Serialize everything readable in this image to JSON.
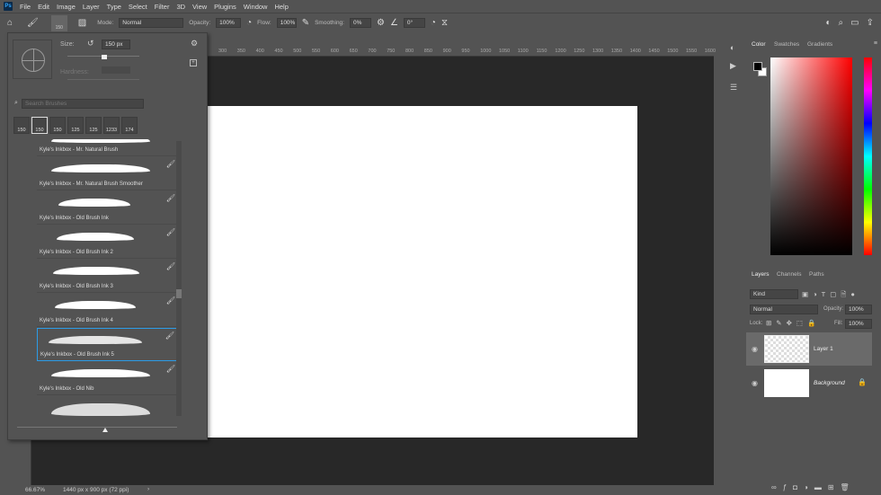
{
  "menu": {
    "logo": "Ps",
    "items": [
      "File",
      "Edit",
      "Image",
      "Layer",
      "Type",
      "Select",
      "Filter",
      "3D",
      "View",
      "Plugins",
      "Window",
      "Help"
    ]
  },
  "options": {
    "brush_size": "150",
    "mode_label": "Mode:",
    "mode": "Normal",
    "opacity_label": "Opacity:",
    "opacity": "100%",
    "flow_label": "Flow:",
    "flow": "100%",
    "smoothing_label": "Smoothing:",
    "smoothing": "0%",
    "angle": "0°"
  },
  "ruler": {
    "ticks": [
      "300",
      "350",
      "400",
      "450",
      "500",
      "550",
      "600",
      "650",
      "700",
      "750",
      "800",
      "850",
      "900",
      "950",
      "1000",
      "1050",
      "1100",
      "1150",
      "1200",
      "1250",
      "1300",
      "1350",
      "1400",
      "1450",
      "1500",
      "1550",
      "1600"
    ]
  },
  "brush_panel": {
    "size_label": "Size:",
    "size": "150 px",
    "hardness_label": "Hardness:",
    "search_placeholder": "Search Brushes",
    "presets": [
      "150",
      "150",
      "150",
      "125",
      "125",
      "1233",
      "174"
    ],
    "brushes": [
      "Kyle's Inkbox - Mr. Natural Brush",
      "Kyle's Inkbox - Mr. Natural Brush Smoother",
      "Kyle's Inkbox - Old Brush Ink",
      "Kyle's Inkbox - Old Brush Ink 2",
      "Kyle's Inkbox - Old Brush Ink 3",
      "Kyle's Inkbox - Old Brush Ink 4",
      "Kyle's Inkbox - Old Brush Ink 5",
      "Kyle's Inkbox - Old Nib"
    ],
    "selected": "Kyle's Inkbox - Old Brush Ink 5"
  },
  "color_panel": {
    "tabs": [
      "Color",
      "Swatches",
      "Gradients"
    ],
    "foreground": "#000000",
    "background": "#ffffff",
    "hue": "#ff0000"
  },
  "layers_panel": {
    "tabs": [
      "Layers",
      "Channels",
      "Paths"
    ],
    "filter": "Kind",
    "blend": "Normal",
    "opacity_label": "Opacity:",
    "opacity": "100%",
    "lock_label": "Lock:",
    "fill_label": "Fill:",
    "fill": "100%",
    "layers": [
      {
        "name": "Layer 1",
        "selected": true
      },
      {
        "name": "Background",
        "locked": true
      }
    ]
  },
  "status": {
    "zoom": "66.67%",
    "doc": "1440 px x 900 px (72 ppi)"
  }
}
